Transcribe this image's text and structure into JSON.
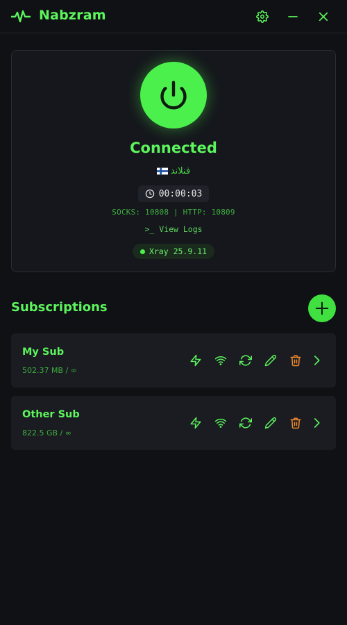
{
  "app": {
    "title": "Nabzram"
  },
  "colors": {
    "accent": "#4cf04c",
    "danger": "#f0892e",
    "background": "#0f1115"
  },
  "connection": {
    "status": "Connected",
    "location": "فنلاند",
    "flag_icon": "finland-flag-icon",
    "elapsed": "00:00:03",
    "ports": "SOCKS: 10808 | HTTP: 10809",
    "logs_label": ">_ View Logs",
    "core_version": "Xray 25.9.11"
  },
  "subscriptions": {
    "title": "Subscriptions",
    "items": [
      {
        "name": "My Sub",
        "usage": "502.37 MB / ∞"
      },
      {
        "name": "Other Sub",
        "usage": "822.5 GB / ∞"
      }
    ]
  }
}
